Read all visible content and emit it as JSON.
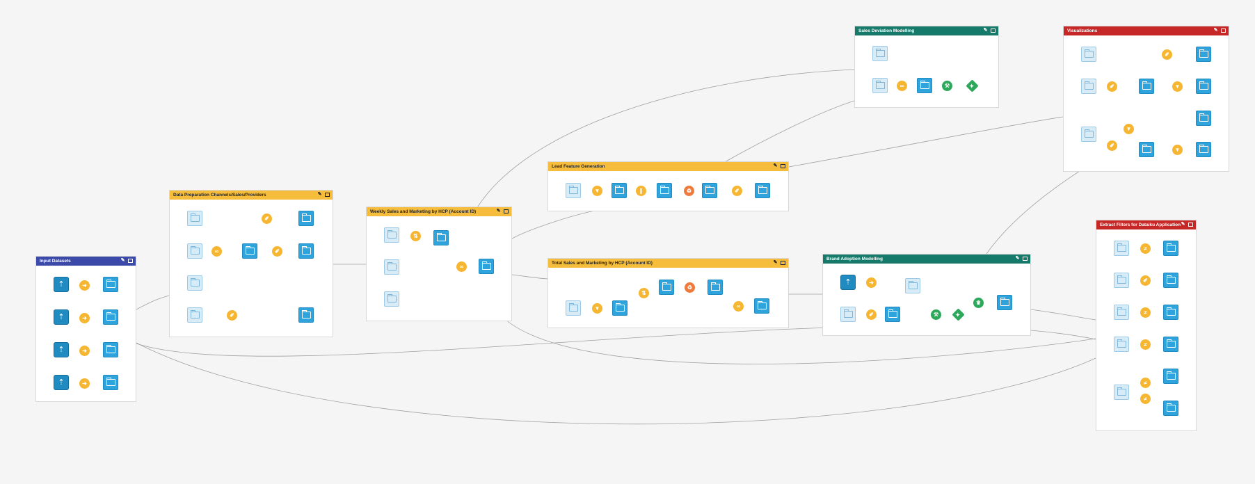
{
  "colors": {
    "background": "#f5f5f5",
    "header_blue": "#3b4aa8",
    "header_yellow": "#f6bd3d",
    "header_teal": "#157a6a",
    "header_red": "#c62828",
    "dataset": "#2fa3dc",
    "recipe": "#f6b632"
  },
  "zones": [
    {
      "title": "Input Datasets",
      "color": "#3b4aa8",
      "text": "dark"
    },
    {
      "title": "Data Preparation Channels/Sales/Providers",
      "color": "#f6bd3d",
      "text": "light"
    },
    {
      "title": "Weekly Sales and Marketing by HCP  (Account ID)",
      "color": "#f6bd3d",
      "text": "light"
    },
    {
      "title": "Lead Feature Generation",
      "color": "#f6bd3d",
      "text": "light"
    },
    {
      "title": "Total Sales and Marketing by HCP (Account ID)",
      "color": "#f6bd3d",
      "text": "light"
    },
    {
      "title": "Sales Deviation Modelling",
      "color": "#157a6a",
      "text": "dark"
    },
    {
      "title": "Brand Adoption Modelling",
      "color": "#157a6a",
      "text": "dark"
    },
    {
      "title": "Visualizations",
      "color": "#c62828",
      "text": "dark"
    },
    {
      "title": "Extract Filters for Dataiku Application",
      "color": "#c62828",
      "text": "dark"
    }
  ],
  "icons": {
    "edit": "pencil-icon",
    "open": "window-icon"
  }
}
